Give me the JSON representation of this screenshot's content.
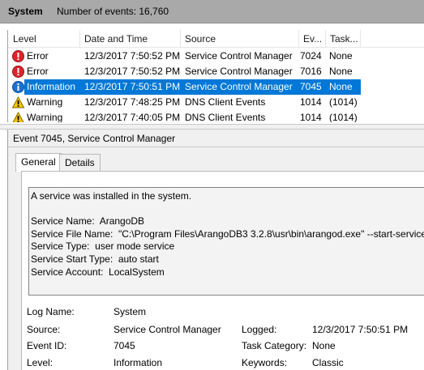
{
  "header": {
    "log_name": "System",
    "event_count_text": "Number of events: 16,760"
  },
  "columns": [
    "Level",
    "Date and Time",
    "Source",
    "Ev...",
    "Task..."
  ],
  "events": [
    {
      "level": "Error",
      "icon": "error-icon",
      "datetime": "12/3/2017 7:50:52 PM",
      "source": "Service Control Manager",
      "event_id": "7024",
      "task": "None",
      "selected": false
    },
    {
      "level": "Error",
      "icon": "error-icon",
      "datetime": "12/3/2017 7:50:52 PM",
      "source": "Service Control Manager",
      "event_id": "7016",
      "task": "None",
      "selected": false
    },
    {
      "level": "Information",
      "icon": "info-icon",
      "datetime": "12/3/2017 7:50:51 PM",
      "source": "Service Control Manager",
      "event_id": "7045",
      "task": "None",
      "selected": true
    },
    {
      "level": "Warning",
      "icon": "warning-icon",
      "datetime": "12/3/2017 7:48:25 PM",
      "source": "DNS Client Events",
      "event_id": "1014",
      "task": "(1014)",
      "selected": false
    },
    {
      "level": "Warning",
      "icon": "warning-icon",
      "datetime": "12/3/2017 7:40:05 PM",
      "source": "DNS Client Events",
      "event_id": "1014",
      "task": "(1014)",
      "selected": false
    }
  ],
  "details": {
    "title": "Event 7045, Service Control Manager",
    "tabs": [
      "General",
      "Details"
    ],
    "active_tab": "General",
    "message": "A service was installed in the system.\n\nService Name:  ArangoDB\nService File Name:  \"C:\\Program Files\\ArangoDB3 3.2.8\\usr\\bin\\arangod.exe\" --start-service\nService Type:  user mode service\nService Start Type:  auto start\nService Account:  LocalSystem",
    "properties": {
      "log_name_label": "Log Name:",
      "log_name_value": "System",
      "source_label": "Source:",
      "source_value": "Service Control Manager",
      "logged_label": "Logged:",
      "logged_value": "12/3/2017 7:50:51 PM",
      "event_id_label": "Event ID:",
      "event_id_value": "7045",
      "task_category_label": "Task Category:",
      "task_category_value": "None",
      "level_label": "Level:",
      "level_value": "Information",
      "keywords_label": "Keywords:",
      "keywords_value": "Classic"
    }
  },
  "colors": {
    "selection": "#0078d7",
    "error": "#d9262c",
    "info": "#1f6fd1",
    "warning": "#f2c500",
    "header_bar": "#a9a9a9"
  }
}
